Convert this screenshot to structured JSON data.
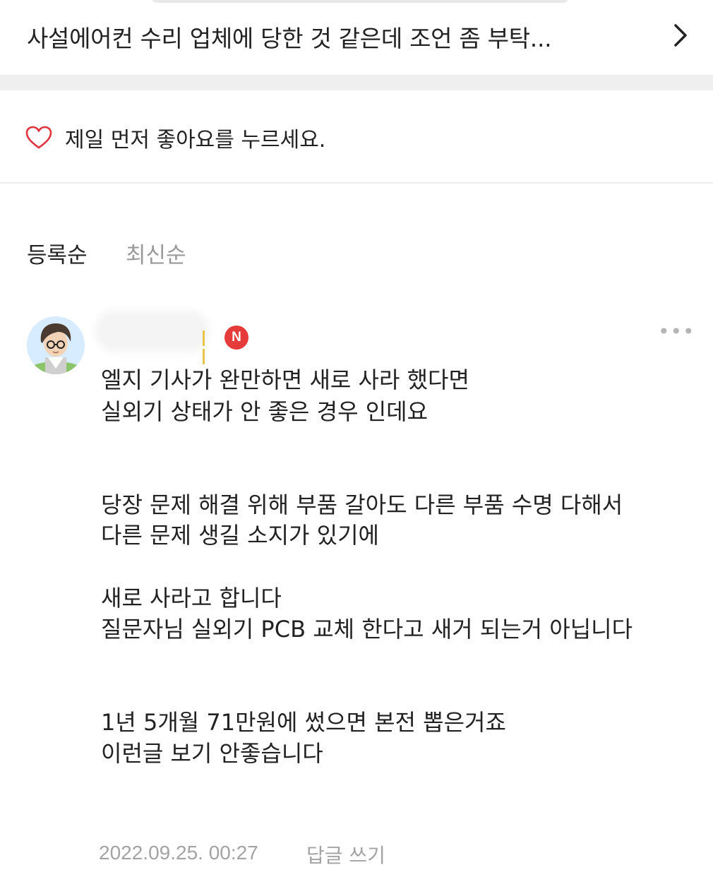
{
  "related_post": {
    "title": "사설에어컨 수리 업체에 당한 것 같은데 조언 좀 부탁..."
  },
  "like_prompt": {
    "text": "제일 먼저 좋아요를 누르세요."
  },
  "sort_tabs": [
    {
      "label": "등록순",
      "active": true
    },
    {
      "label": "최신순",
      "active": false
    }
  ],
  "comment": {
    "badge": "N",
    "lines": [
      "엘지 기사가 완만하면 새로 사라 했다면",
      "실외기 상태가 안 좋은 경우 인데요",
      "당장 문제 해결 위해 부품 갈아도 다른 부품 수명 다해서",
      "다른 문제 생길 소지가 있기에",
      "새로 사라고 합니다",
      "질문자님 실외기 PCB 교체 한다고 새거 되는거 아닙니다",
      "1년 5개월 71만원에 썼으면 본전 뽑은거죠",
      "이런글 보기 안좋습니다"
    ],
    "date": "2022.09.25. 00:27",
    "reply_label": "답글 쓰기"
  },
  "colors": {
    "badge_red": "#e63b3b",
    "heart_red": "#e0323c",
    "muted_text": "#a3a3a3"
  },
  "icons": [
    "chevron-right-icon",
    "heart-outline-icon",
    "more-options-icon"
  ]
}
